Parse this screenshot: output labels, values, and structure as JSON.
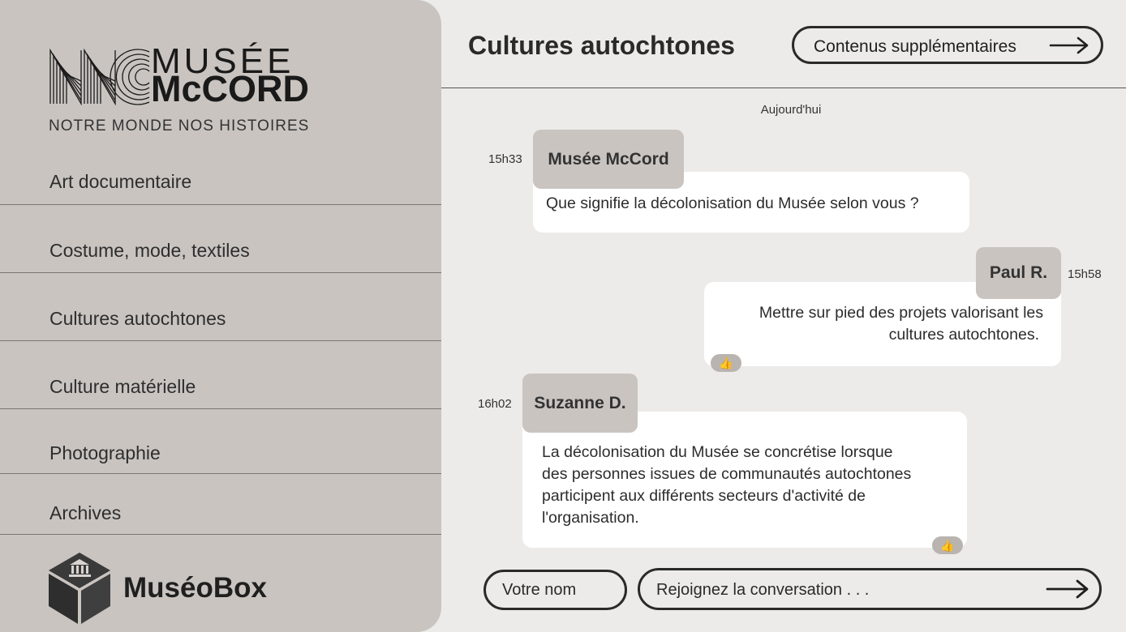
{
  "sidebar": {
    "logo": {
      "line1": "MUSÉE",
      "line2": "McCORD",
      "tagline": "NOTRE MONDE NOS HISTOIRES"
    },
    "items": [
      {
        "label": "Art documentaire"
      },
      {
        "label": "Costume, mode, textiles"
      },
      {
        "label": "Cultures autochtones"
      },
      {
        "label": "Culture matérielle"
      },
      {
        "label": "Photographie"
      },
      {
        "label": "Archives"
      }
    ],
    "brand": {
      "name": "MuséoBox",
      "icon": "museum-box-icon"
    }
  },
  "header": {
    "title": "Cultures autochtones",
    "extra_button": "Contenus supplémentaires",
    "extra_icon": "arrow-right-icon"
  },
  "chat": {
    "date_label": "Aujourd'hui",
    "messages": [
      {
        "time": "15h33",
        "author": "Musée McCord",
        "text": "Que signifie la décolonisation du Musée selon vous ?"
      },
      {
        "time": "15h58",
        "author": "Paul R.",
        "text_lines": [
          "Mettre sur pied des projets valorisant les",
          "cultures autochtones."
        ],
        "reaction": "👍"
      },
      {
        "time": "16h02",
        "author": "Suzanne D.",
        "text_lines": [
          "La décolonisation du Musée se concrétise lorsque",
          "des personnes issues de communautés autochtones",
          "participent aux différents secteurs d'activité de",
          "l'organisation."
        ],
        "reaction": "👍"
      }
    ]
  },
  "composer": {
    "name_placeholder": "Votre nom",
    "message_placeholder": "Rejoignez la conversation . . .",
    "send_icon": "arrow-right-icon"
  },
  "colors": {
    "sidebar_bg": "#c9c4c0",
    "page_bg": "#ecebe9",
    "bubble_bg": "#ffffff",
    "text": "#2b2b2b"
  }
}
